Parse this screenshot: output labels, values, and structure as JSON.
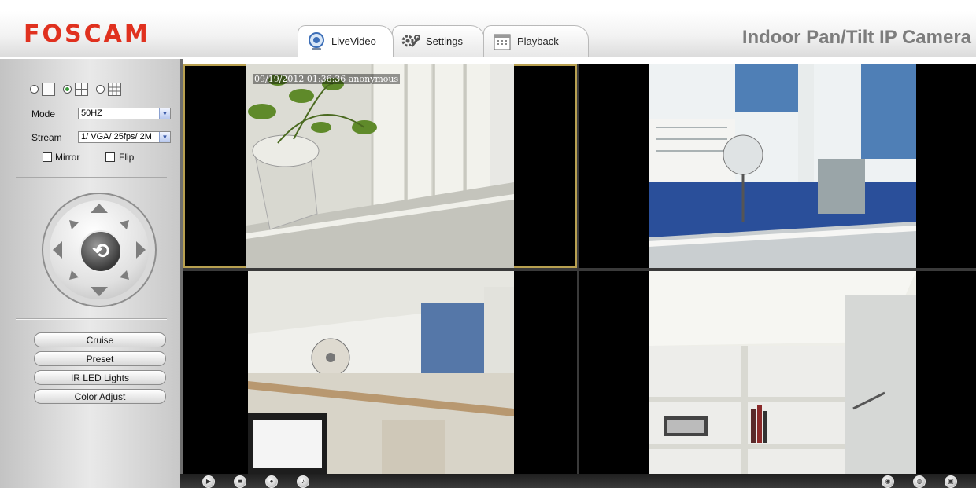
{
  "header": {
    "logo": "FOSCAM",
    "product_title": "Indoor Pan/Tilt IP Camera",
    "tabs": [
      {
        "label": "LiveVideo",
        "icon": "webcam-icon",
        "active": true
      },
      {
        "label": "Settings",
        "icon": "gears-icon",
        "active": false
      },
      {
        "label": "Playback",
        "icon": "calendar-icon",
        "active": false
      }
    ]
  },
  "controls": {
    "layout_options": [
      {
        "icon": "single-view-icon",
        "selected": false
      },
      {
        "icon": "quad-view-icon",
        "selected": true
      },
      {
        "icon": "nine-view-icon",
        "selected": false
      }
    ],
    "mode_label": "Mode",
    "mode_value": "50HZ",
    "stream_label": "Stream",
    "stream_value": "1/ VGA/ 25fps/ 2M",
    "mirror_label": "Mirror",
    "mirror_checked": false,
    "flip_label": "Flip",
    "flip_checked": false
  },
  "buttons": {
    "cruise": "Cruise",
    "preset": "Preset",
    "ir_led": "IR LED Lights",
    "color_adjust": "Color Adjust"
  },
  "video": {
    "osd_timestamp": "09/19/2012 01:36:36",
    "osd_user": "anonymous"
  },
  "toolbar": {
    "left_icons": [
      "play-icon",
      "stop-icon",
      "microphone-icon",
      "talk-icon"
    ],
    "right_icons": [
      "snapshot-icon",
      "record-icon",
      "fullscreen-icon"
    ]
  },
  "colors": {
    "brand": "#e0311f",
    "title_gray": "#7d7d7d",
    "radio_selected": "#3a9a3a"
  }
}
